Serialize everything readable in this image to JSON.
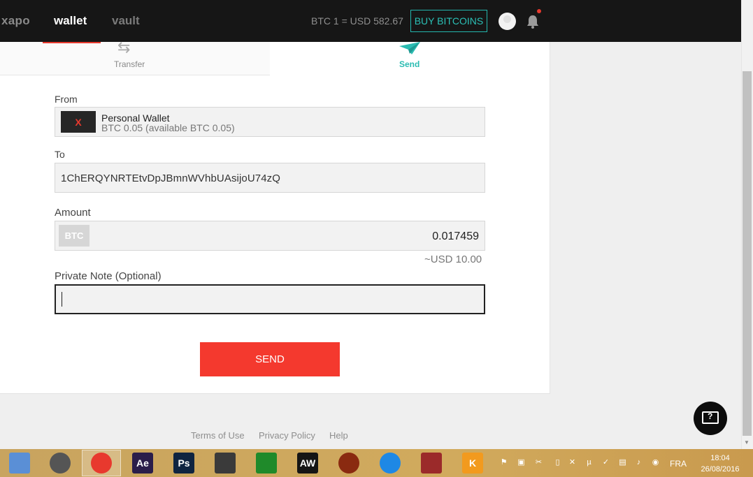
{
  "nav": {
    "brand": "xapo",
    "wallet": "wallet",
    "vault": "vault",
    "rate": "BTC 1 = USD 582.67",
    "buy": "BUY BITCOINS"
  },
  "tabs": {
    "transfer": "Transfer",
    "send": "Send"
  },
  "form": {
    "from_label": "From",
    "from_thumb": "X",
    "from_wallet": "Personal Wallet",
    "from_balance": "BTC 0.05 (available BTC 0.05)",
    "to_label": "To",
    "to_value": "1ChERQYNRTEtvDpJBmnWVhbUAsijoU74zQ",
    "amount_label": "Amount",
    "currency": "BTC",
    "amount_value": "0.017459",
    "usd_equiv": "~USD 10.00",
    "note_label": "Private Note (Optional)",
    "note_value": "",
    "send_button": "SEND"
  },
  "footer": {
    "terms": "Terms of Use",
    "privacy": "Privacy Policy",
    "help": "Help"
  },
  "taskbar": {
    "lang": "FRA",
    "time": "18:04",
    "date": "26/08/2016",
    "apps": [
      {
        "name": "file-explorer-icon",
        "color": "#5a8fd6"
      },
      {
        "name": "film-reel-icon",
        "color": "#555"
      },
      {
        "name": "chrome-icon",
        "color": "#e8392e"
      },
      {
        "name": "after-effects-icon",
        "label": "Ae",
        "color": "#2a1d4a"
      },
      {
        "name": "photoshop-icon",
        "label": "Ps",
        "color": "#0f2440"
      },
      {
        "name": "world-of-tanks-icon",
        "color": "#3a3a3a"
      },
      {
        "name": "calculator-icon",
        "color": "#1f8a2a"
      },
      {
        "name": "aw-icon",
        "label": "AW",
        "color": "#151515"
      },
      {
        "name": "game-character-icon",
        "color": "#8a2a10"
      },
      {
        "name": "internet-explorer-icon",
        "color": "#1e88e5"
      },
      {
        "name": "folder-icon",
        "color": "#9b2a2a"
      },
      {
        "name": "kmplayer-icon",
        "label": "K",
        "color": "#f29a1e"
      }
    ]
  }
}
